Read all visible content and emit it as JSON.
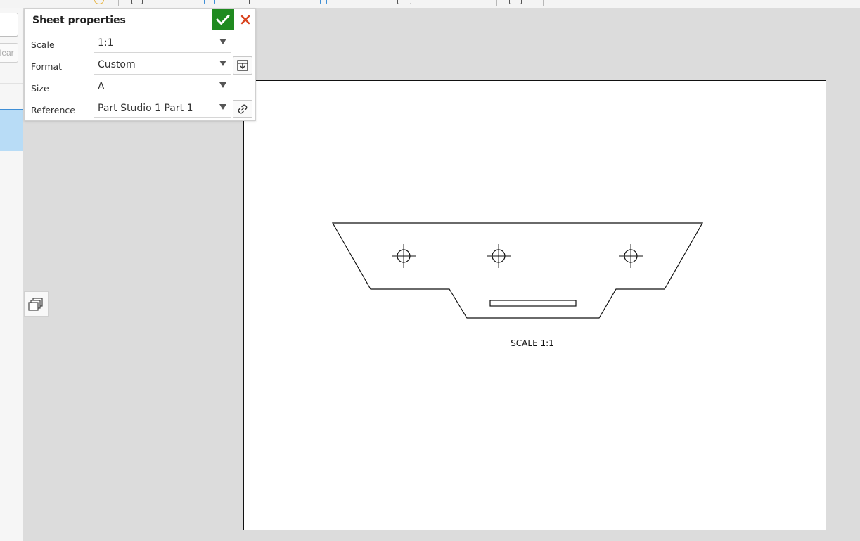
{
  "dialog": {
    "title": "Sheet properties",
    "rows": [
      {
        "label": "Scale",
        "value": "1:1"
      },
      {
        "label": "Format",
        "value": "Custom"
      },
      {
        "label": "Size",
        "value": "A"
      },
      {
        "label": "Reference",
        "value": "Part Studio 1 Part 1"
      }
    ],
    "ok_icon": "checkmark-icon",
    "cancel_icon": "close-icon",
    "format_action_icon": "insert-format-icon",
    "reference_action_icon": "link-icon"
  },
  "left_panel": {
    "clear_label": "Clear"
  },
  "drawing": {
    "scale_note": "SCALE 1:1"
  },
  "colors": {
    "ok": "#1f8a20",
    "cancel": "#d9441f",
    "selection": "#b8dcf6",
    "selection_border": "#3f8fd6"
  }
}
